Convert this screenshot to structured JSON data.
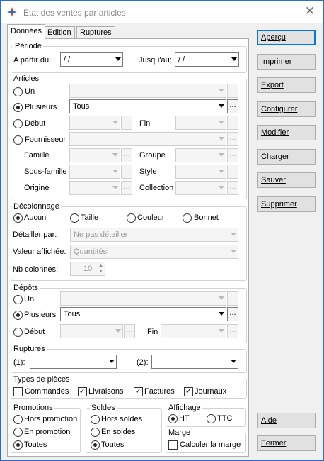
{
  "title": "Etat des ventes par articles",
  "tabs": [
    "Données",
    "Edition",
    "Ruptures"
  ],
  "periode": {
    "legend": "Période",
    "from_label": "A partir du:",
    "from_value": " /  /",
    "to_label": "Jusqu'au:",
    "to_value": " /  /"
  },
  "articles": {
    "legend": "Articles",
    "un": "Un",
    "plusieurs": "Plusieurs",
    "plusieurs_value": "Tous",
    "debut": "Début",
    "fin": "Fin",
    "fournisseur": "Fournisseur",
    "famille": "Famille",
    "groupe": "Groupe",
    "sous_famille": "Sous-famille",
    "style": "Style",
    "origine": "Origine",
    "collection": "Collection"
  },
  "decolonnage": {
    "legend": "Décolonnage",
    "options": [
      "Aucun",
      "Taille",
      "Couleur",
      "Bonnet"
    ],
    "detailler_label": "Détailler par:",
    "detailler_value": "Ne pas détailler",
    "valeur_label": "Valeur affichée:",
    "valeur_value": "Quantités",
    "nb_label": "Nb colonnes:",
    "nb_value": "10"
  },
  "depots": {
    "legend": "Dépôts",
    "un": "Un",
    "plusieurs": "Plusieurs",
    "plusieurs_value": "Tous",
    "debut": "Début",
    "fin": "Fin"
  },
  "ruptures": {
    "legend": "Ruptures",
    "r1": "(1):",
    "r2": "(2):"
  },
  "types": {
    "legend": "Types de pièces",
    "items": [
      "Commandes",
      "Livraisons",
      "Factures",
      "Journaux"
    ],
    "checked": [
      false,
      true,
      true,
      true
    ]
  },
  "promotions": {
    "legend": "Promotions",
    "items": [
      "Hors promotion",
      "En promotion",
      "Toutes"
    ]
  },
  "soldes": {
    "legend": "Soldes",
    "items": [
      "Hors soldes",
      "En soldes",
      "Toutes"
    ]
  },
  "affichage": {
    "legend": "Affichage",
    "ht": "HT",
    "ttc": "TTC"
  },
  "marge": {
    "legend": "Marge",
    "calc": "Calculer la marge"
  },
  "buttons": {
    "apercu": "Aperçu",
    "imprimer": "Imprimer",
    "export": "Export",
    "configurer": "Configurer",
    "modifier": "Modifier",
    "charger": "Charger",
    "sauver": "Sauver",
    "supprimer": "Supprimer",
    "aide": "Aide",
    "fermer": "Fermer"
  },
  "colors": {
    "accent": "#0078d7",
    "border": "#2b6fc5"
  }
}
